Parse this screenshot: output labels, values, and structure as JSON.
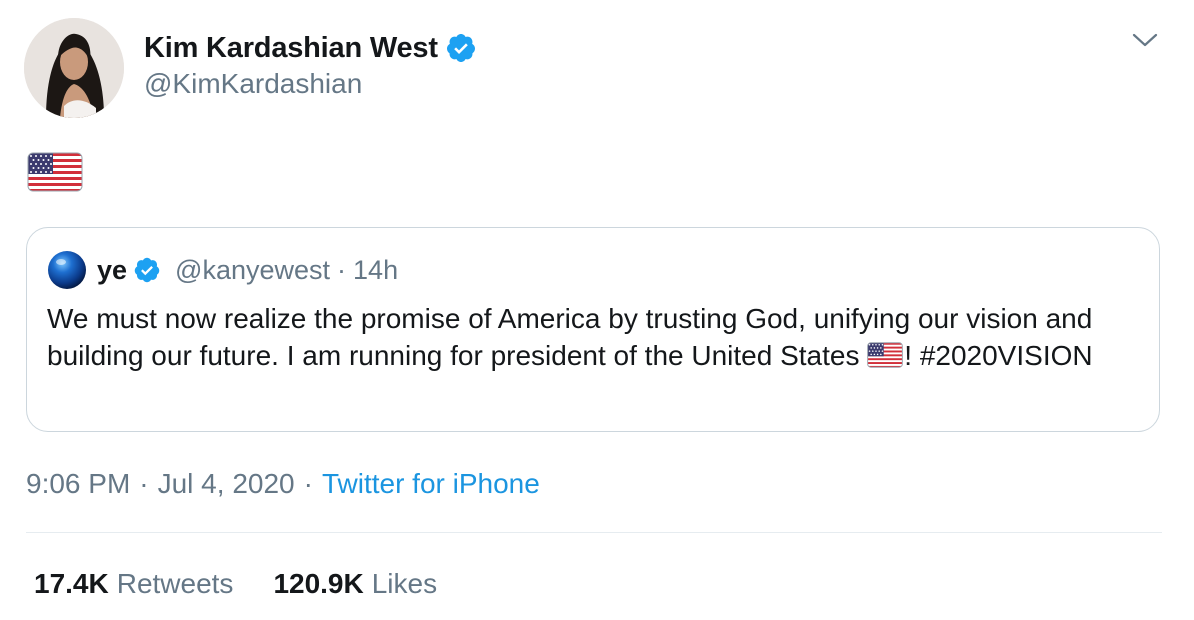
{
  "colors": {
    "accent": "#1da1f2",
    "link": "#1b95e0",
    "text_primary": "#14171a",
    "text_secondary": "#657786",
    "border": "#ccd6dd"
  },
  "tweet": {
    "author": {
      "display_name": "Kim Kardashian West",
      "handle": "@KimKardashian",
      "verified_icon": "verified-badge-icon"
    },
    "more_icon": "chevron-down-icon",
    "body_emoji": "us-flag-emoji",
    "quoted_tweet": {
      "display_name": "ye",
      "verified_icon": "verified-badge-icon",
      "handle": "@kanyewest",
      "separator": "·",
      "time_ago": "14h",
      "text_line_1": "We must now realize the promise of America by trusting God, unifying our vision and building our future. I am running for president of the United States ",
      "inline_emoji": "us-flag-emoji",
      "text_after_emoji": "! #2020VISION"
    },
    "meta": {
      "time": "9:06 PM",
      "separator_1": "·",
      "date": "Jul 4, 2020",
      "separator_2": "·",
      "source": "Twitter for iPhone"
    },
    "stats": {
      "retweets_count": "17.4K",
      "retweets_label": "Retweets",
      "likes_count": "120.9K",
      "likes_label": "Likes"
    }
  }
}
